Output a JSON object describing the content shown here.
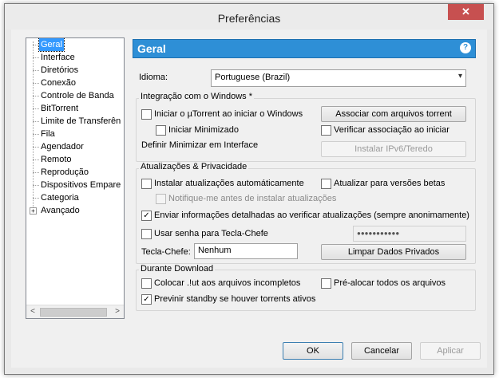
{
  "window": {
    "title": "Preferências",
    "close_label": "✕"
  },
  "tree": {
    "items": [
      {
        "label": "Geral",
        "selected": true
      },
      {
        "label": "Interface"
      },
      {
        "label": "Diretórios"
      },
      {
        "label": "Conexão"
      },
      {
        "label": "Controle de Banda"
      },
      {
        "label": "BitTorrent"
      },
      {
        "label": "Limite de Transferên"
      },
      {
        "label": "Fila"
      },
      {
        "label": "Agendador"
      },
      {
        "label": "Remoto"
      },
      {
        "label": "Reprodução"
      },
      {
        "label": "Dispositivos Empare"
      },
      {
        "label": "Categoria"
      },
      {
        "label": "Avançado",
        "expander": "+"
      }
    ],
    "scroll_left": "<",
    "scroll_right": ">"
  },
  "header": {
    "title": "Geral",
    "help": "?"
  },
  "language": {
    "label": "Idioma:",
    "value": "Portuguese (Brazil)",
    "caret": "▾"
  },
  "windows_group": {
    "title": "Integração com o Windows *",
    "start_with_windows": "Iniciar o µTorrent ao iniciar o Windows",
    "start_minimized": "Iniciar Minimizado",
    "minimize_label": "Definir Minimizar em Interface",
    "associate_button": "Associar com arquivos torrent",
    "check_association": "Verificar associação ao iniciar",
    "ipv6_button": "Instalar IPv6/Teredo"
  },
  "updates_group": {
    "title": "Atualizações & Privacidade",
    "auto_update": "Instalar atualizações automáticamente",
    "beta_update": "Atualizar para versões betas",
    "notify_before": "Notifique-me antes de instalar atualizações",
    "send_info": "Enviar informações detalhadas ao verificar atualizações (sempre anonimamente)",
    "send_info_check": "✓",
    "use_password": "Usar senha para Tecla-Chefe",
    "password_mask": "●●●●●●●●●●●",
    "boss_key_label": "Tecla-Chefe:",
    "boss_key_value": "Nenhum",
    "clear_private_button": "Limpar Dados Privados"
  },
  "download_group": {
    "title": "Durante Download",
    "append_ut": "Colocar .!ut aos arquivos incompletos",
    "prealloc": "Pré-alocar todos os arquivos",
    "prevent_standby": "Previnir standby se houver torrents ativos",
    "prevent_standby_check": "✓"
  },
  "buttons": {
    "ok": "OK",
    "cancel": "Cancelar",
    "apply": "Aplicar"
  }
}
